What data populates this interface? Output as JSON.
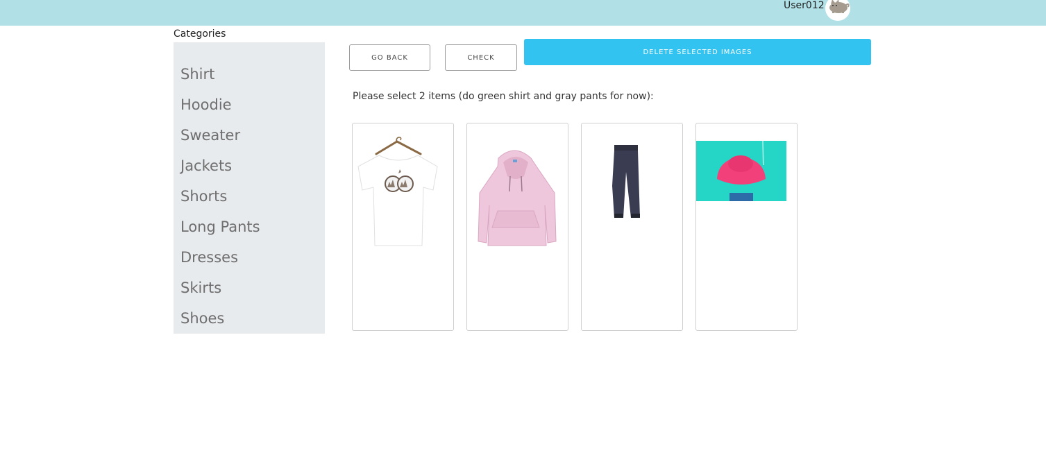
{
  "header": {
    "username": "User012",
    "avatar_icon": "cat-avatar-icon",
    "bg_color": "#b1e0e6"
  },
  "sidebar": {
    "title": "Categories",
    "items": [
      {
        "label": "Shirt"
      },
      {
        "label": "Hoodie"
      },
      {
        "label": "Sweater"
      },
      {
        "label": "Jackets"
      },
      {
        "label": "Shorts"
      },
      {
        "label": "Long Pants"
      },
      {
        "label": "Dresses"
      },
      {
        "label": "Skirts"
      },
      {
        "label": "Shoes"
      }
    ]
  },
  "toolbar": {
    "go_back_label": "Go Back",
    "check_label": "Check",
    "delete_label": "Delete Selected Images",
    "accent_color": "#33c3f0"
  },
  "main": {
    "instruction": "Please select 2 items (do green shirt and gray pants for now):",
    "items": [
      {
        "image": "white-tshirt-image"
      },
      {
        "image": "pink-hoodie-image"
      },
      {
        "image": "navy-pants-image"
      },
      {
        "image": "pink-hat-image"
      }
    ]
  }
}
